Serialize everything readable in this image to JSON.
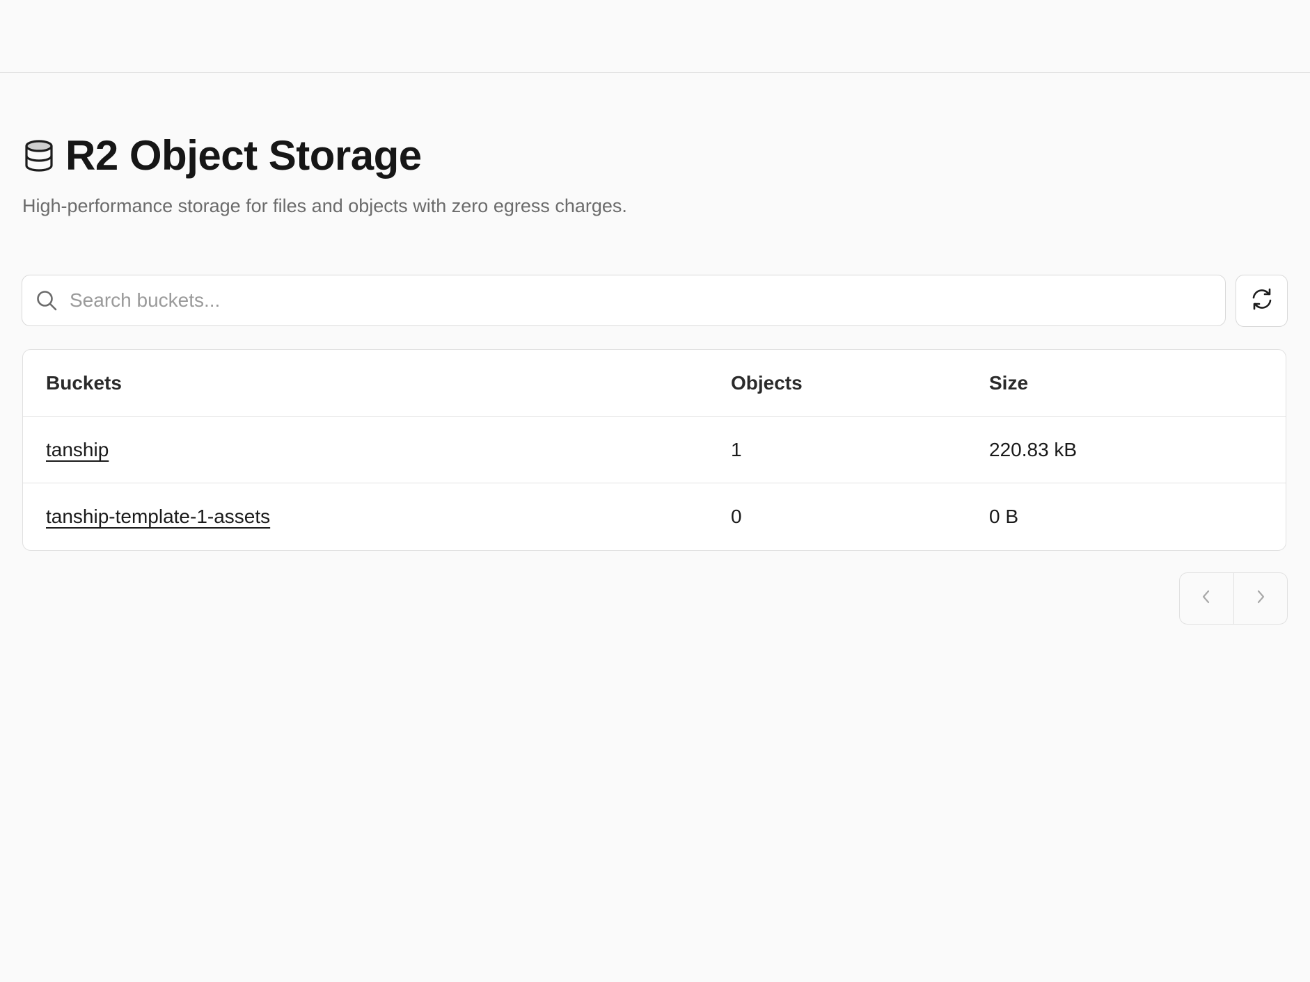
{
  "header": {
    "icon": "database-icon",
    "title": "R2 Object Storage",
    "subtitle": "High-performance storage for files and objects with zero egress charges."
  },
  "search": {
    "icon": "search-icon",
    "placeholder": "Search buckets...",
    "value": ""
  },
  "toolbar": {
    "refresh_icon": "refresh-icon"
  },
  "table": {
    "columns": [
      "Buckets",
      "Objects",
      "Size"
    ],
    "rows": [
      {
        "bucket": "tanship",
        "objects": "1",
        "size": "220.83 kB"
      },
      {
        "bucket": "tanship-template-1-assets",
        "objects": "0",
        "size": "0 B"
      }
    ]
  },
  "pagination": {
    "prev_icon": "chevron-left-icon",
    "next_icon": "chevron-right-icon"
  },
  "colors": {
    "background": "#fafafa",
    "border": "#d9d9d9",
    "text_primary": "#1a1a1a",
    "text_muted": "#6b6b6b"
  }
}
